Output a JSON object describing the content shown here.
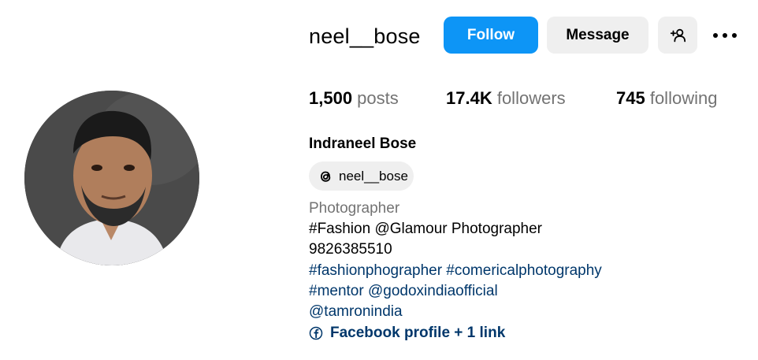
{
  "profile": {
    "username": "neel__bose",
    "full_name": "Indraneel Bose",
    "threads_handle": "neel__bose"
  },
  "actions": {
    "follow_label": "Follow",
    "message_label": "Message"
  },
  "stats": {
    "posts_count": "1,500",
    "posts_label": " posts",
    "followers_count": "17.4K",
    "followers_label": " followers",
    "following_count": "745",
    "following_label": " following"
  },
  "bio": {
    "category": "Photographer",
    "line1": "#Fashion @Glamour Photographer",
    "line2": "9826385510",
    "line3": "#fashionphographer #comericalphotography",
    "line4": "#mentor @godoxindiaofficial",
    "line5": "@tamronindia",
    "link_text": "Facebook profile + 1 link"
  },
  "colors": {
    "follow_button": "#0d95f6",
    "secondary_button": "#efefef",
    "link": "#00376b",
    "muted_text": "#737373"
  },
  "icons": {
    "add_user": "add-person-icon",
    "more": "more-horizontal-icon",
    "threads": "threads-logo-icon",
    "facebook": "facebook-icon"
  }
}
